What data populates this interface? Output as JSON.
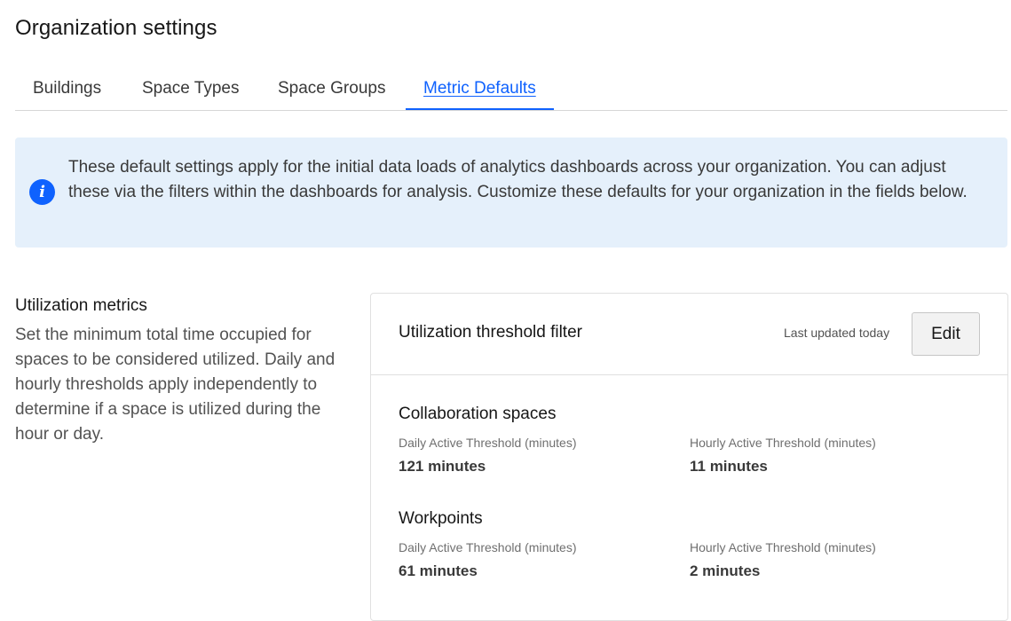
{
  "page": {
    "title": "Organization settings"
  },
  "tabs": [
    {
      "label": "Buildings",
      "active": false
    },
    {
      "label": "Space Types",
      "active": false
    },
    {
      "label": "Space Groups",
      "active": false
    },
    {
      "label": "Metric Defaults",
      "active": true
    }
  ],
  "info_banner": {
    "icon": "info-icon",
    "text": "These default settings apply for the initial data loads of analytics dashboards across your organization. You can adjust these via the filters within the dashboards for analysis. Customize these defaults for your organization in the fields below."
  },
  "utilization_section": {
    "title": "Utilization metrics",
    "description": "Set the minimum total time occupied for spaces to be considered utilized. Daily and hourly thresholds apply independently to determine if a space is utilized during the hour or day."
  },
  "threshold_card": {
    "title": "Utilization threshold filter",
    "last_updated": "Last updated today",
    "edit_label": "Edit",
    "groups": [
      {
        "title": "Collaboration spaces",
        "daily_label": "Daily Active Threshold (minutes)",
        "daily_value": "121 minutes",
        "hourly_label": "Hourly Active Threshold (minutes)",
        "hourly_value": "11 minutes"
      },
      {
        "title": "Workpoints",
        "daily_label": "Daily Active Threshold (minutes)",
        "daily_value": "61 minutes",
        "hourly_label": "Hourly Active Threshold (minutes)",
        "hourly_value": "2 minutes"
      }
    ]
  },
  "colors": {
    "accent": "#0f62fe",
    "banner_bg": "#e5f0fb"
  }
}
